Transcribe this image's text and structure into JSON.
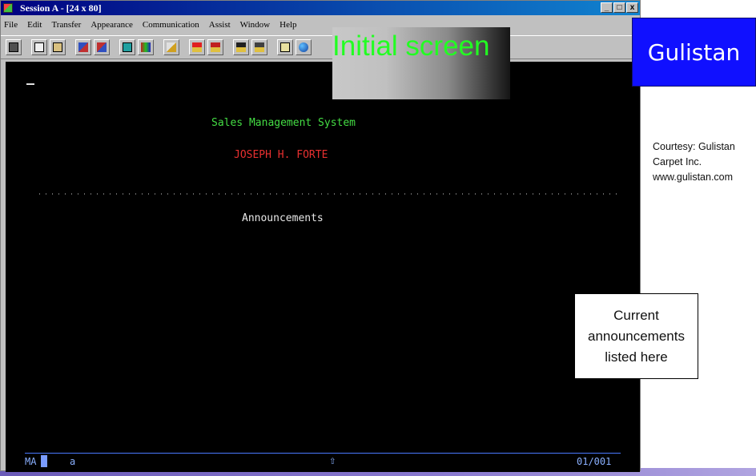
{
  "window": {
    "title": "Session A - [24 x 80]",
    "buttons": [
      "_",
      "□",
      "x"
    ]
  },
  "menubar": [
    "File",
    "Edit",
    "Transfer",
    "Appearance",
    "Communication",
    "Assist",
    "Window",
    "Help"
  ],
  "toolbar": {
    "icons": [
      "print-screen-icon",
      "copy-icon",
      "paste-icon",
      "send-file-icon",
      "receive-file-icon",
      "display-icon",
      "color-map-icon",
      "edit-icon",
      "play-macro-icon",
      "record-macro-icon",
      "stop-macro-icon",
      "step-macro-icon",
      "clipboard-icon",
      "globe-icon"
    ]
  },
  "terminal": {
    "system_title": "Sales Management System",
    "user_name": "JOSEPH H. FORTE",
    "section_title": "Announcements",
    "status": {
      "mode": "MA",
      "input": "a",
      "shift_indicator": "⇧",
      "position": "01/001"
    },
    "colors": {
      "background": "#000000",
      "title": "#44dd44",
      "user": "#e83030",
      "text": "#e8e8e8"
    }
  },
  "callouts": {
    "screen_label": "Initial screen",
    "brand": "Gulistan",
    "courtesy": [
      "Courtesy: Gulistan",
      "Carpet Inc.",
      "www.gulistan.com"
    ],
    "note": [
      "Current",
      "announcements",
      "listed here"
    ]
  }
}
